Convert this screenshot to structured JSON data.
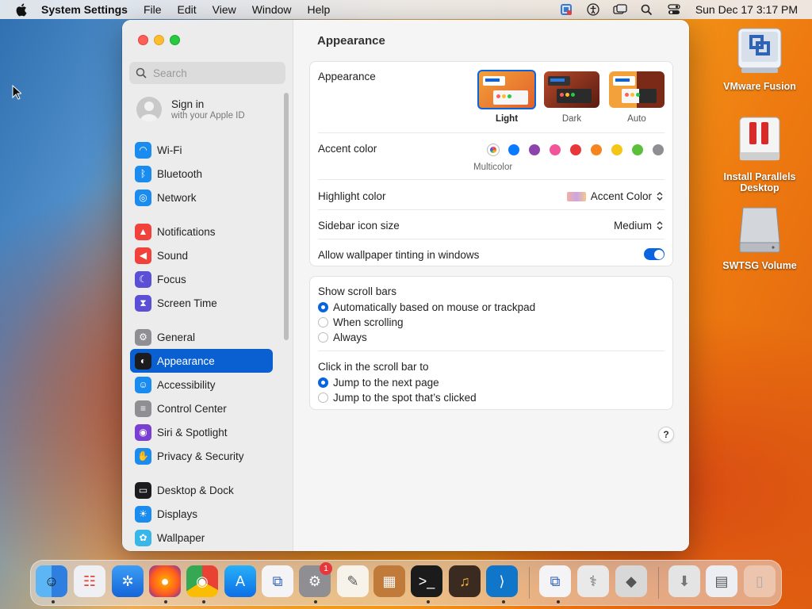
{
  "menubar": {
    "app_name": "System Settings",
    "menus": [
      "File",
      "Edit",
      "View",
      "Window",
      "Help"
    ],
    "clock": "Sun Dec 17  3:17 PM"
  },
  "sidebar": {
    "search_placeholder": "Search",
    "signin_title": "Sign in",
    "signin_subtitle": "with your Apple ID",
    "items": [
      {
        "label": "Wi-Fi",
        "icon": "wifi-icon",
        "color": "#1a8cf0"
      },
      {
        "label": "Bluetooth",
        "icon": "bluetooth-icon",
        "color": "#1a8cf0"
      },
      {
        "label": "Network",
        "icon": "globe-icon",
        "color": "#1a8cf0"
      },
      {
        "label": "Notifications",
        "icon": "bell-icon",
        "color": "#f0413a"
      },
      {
        "label": "Sound",
        "icon": "speaker-icon",
        "color": "#f0413a"
      },
      {
        "label": "Focus",
        "icon": "moon-icon",
        "color": "#5b4fd6"
      },
      {
        "label": "Screen Time",
        "icon": "hourglass-icon",
        "color": "#5b4fd6"
      },
      {
        "label": "General",
        "icon": "gear-icon",
        "color": "#8e8e93"
      },
      {
        "label": "Appearance",
        "icon": "appearance-icon",
        "color": "#1c1c1e"
      },
      {
        "label": "Accessibility",
        "icon": "accessibility-icon",
        "color": "#1a8cf0"
      },
      {
        "label": "Control Center",
        "icon": "toggles-icon",
        "color": "#8e8e93"
      },
      {
        "label": "Siri & Spotlight",
        "icon": "siri-icon",
        "color": "#7a3ed0"
      },
      {
        "label": "Privacy & Security",
        "icon": "hand-icon",
        "color": "#1a8cf0"
      },
      {
        "label": "Desktop & Dock",
        "icon": "dock-icon",
        "color": "#1c1c1e"
      },
      {
        "label": "Displays",
        "icon": "display-icon",
        "color": "#1a8cf0"
      },
      {
        "label": "Wallpaper",
        "icon": "wallpaper-icon",
        "color": "#38b6e8"
      }
    ],
    "selected": "Appearance"
  },
  "content": {
    "title": "Appearance",
    "appearance_label": "Appearance",
    "appearance_options": [
      "Light",
      "Dark",
      "Auto"
    ],
    "appearance_selected": "Light",
    "accent_label": "Accent color",
    "accent_caption": "Multicolor",
    "accent_colors": [
      "#0a7aff",
      "#8e44ad",
      "#f2559a",
      "#e8373a",
      "#f5861f",
      "#f5c518",
      "#5bbf3a",
      "#8e8e93"
    ],
    "highlight_label": "Highlight color",
    "highlight_value": "Accent Color",
    "icon_size_label": "Sidebar icon size",
    "icon_size_value": "Medium",
    "tinting_label": "Allow wallpaper tinting in windows",
    "tinting_on": true,
    "scrollbars_label": "Show scroll bars",
    "scrollbars_options": [
      "Automatically based on mouse or trackpad",
      "When scrolling",
      "Always"
    ],
    "click_label": "Click in the scroll bar to",
    "click_options": [
      "Jump to the next page",
      "Jump to the spot that’s clicked"
    ],
    "help": "?"
  },
  "desktop": {
    "icons": [
      "VMware Fusion",
      "Install Parallels Desktop",
      "SWTSG Volume"
    ]
  },
  "dock": {
    "badge": "1",
    "apps": [
      "finder-icon",
      "launchpad-icon",
      "safari-icon",
      "firefox-icon",
      "chrome-icon",
      "app-store-icon",
      "vmware-icon",
      "system-settings-icon",
      "textedit-icon",
      "archive-icon",
      "terminal-icon",
      "garageband-icon",
      "vscode-icon",
      "vmware-fusion-icon",
      "disk-utility-icon",
      "bootcamp-icon",
      "downloads-icon",
      "documents-icon",
      "trash-icon"
    ]
  }
}
